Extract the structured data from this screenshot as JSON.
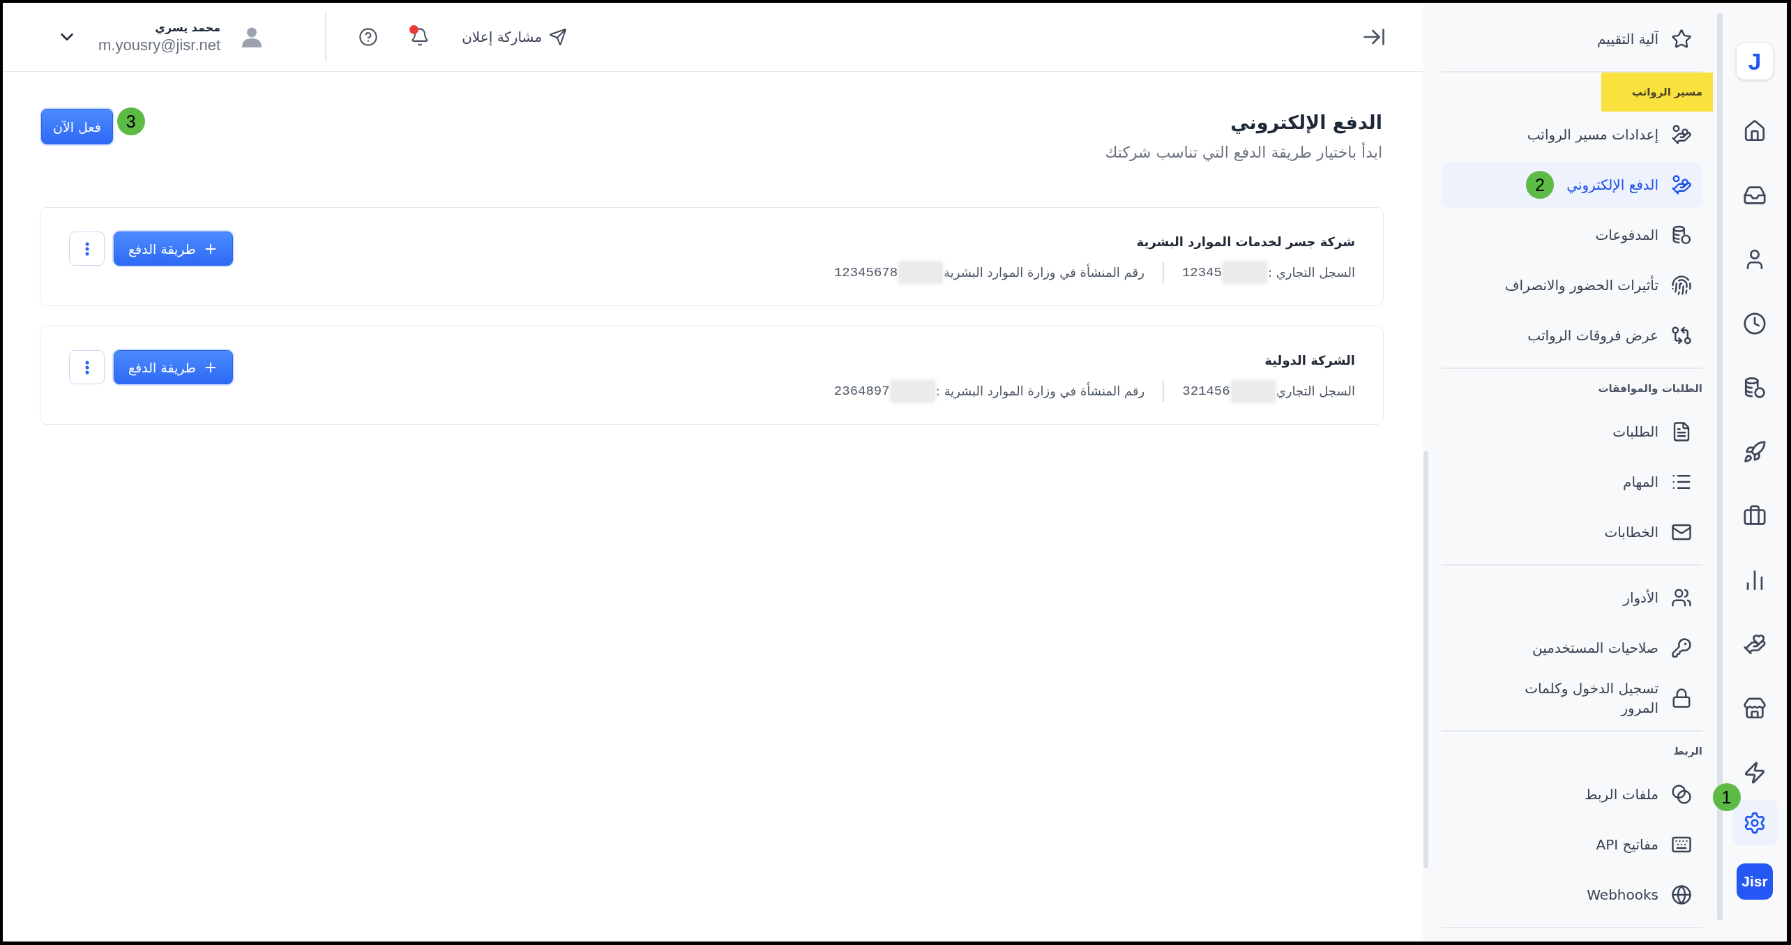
{
  "header": {
    "share_announcement": {
      "label": "مشاركة إعلان"
    },
    "notifications": {
      "unread": true
    },
    "user": {
      "name": "محمد يسري",
      "email": "m.yousry@jisr.net"
    }
  },
  "page": {
    "title": "الدفع الإلكتروني",
    "subtitle": "ابدأ باختيار طريقة الدفع التي تناسب شركتك",
    "action": {
      "label": "فعل الآن",
      "annotation": "3"
    }
  },
  "companies": [
    {
      "name": "شركة جسر لخدمات الموارد البشرية",
      "fields": [
        {
          "label": "السجل التجاري :",
          "value": "12345",
          "redacted": true
        },
        {
          "label": "رقم المنشأة في وزارة الموارد البشرية",
          "value": "12345678",
          "redacted": true
        }
      ],
      "add_button": "طريقة الدفع"
    },
    {
      "name": "الشركة الدولية",
      "fields": [
        {
          "label": "السجل التجاري",
          "value": "321456",
          "redacted": true
        },
        {
          "label": "رقم المنشأة في وزارة الموارد البشرية :",
          "value": "2364897",
          "redacted": true
        }
      ],
      "add_button": "طريقة الدفع"
    }
  ],
  "sidebar": {
    "sections": [
      {
        "items": [
          {
            "label": "آلية التقييم",
            "selected": false
          }
        ]
      },
      {
        "heading": "مسير الرواتب",
        "highlighted": true,
        "items": [
          {
            "label": "إعدادات مسير الرواتب",
            "selected": false
          },
          {
            "label": "الدفع الإلكتروني",
            "selected": true,
            "annotation": "2"
          },
          {
            "label": "المدفوعات",
            "selected": false
          },
          {
            "label": "تأثيرات الحضور والانصراف",
            "selected": false
          },
          {
            "label": "عرض فروقات الرواتب",
            "selected": false
          }
        ]
      },
      {
        "heading": "الطلبات والموافقات",
        "highlighted": false,
        "items": [
          {
            "label": "الطلبات",
            "selected": false
          },
          {
            "label": "المهام",
            "selected": false
          },
          {
            "label": "الخطابات",
            "selected": false
          }
        ]
      },
      {
        "items": [
          {
            "label": "الأدوار",
            "selected": false
          },
          {
            "label": "صلاحيات المستخدمين",
            "selected": false
          },
          {
            "label": "تسجيل الدخول وكلمات المرور",
            "selected": false
          }
        ]
      },
      {
        "heading": "الربط",
        "highlighted": false,
        "items": [
          {
            "label": "ملفات الربط",
            "selected": false
          },
          {
            "label": "مفاتيح API",
            "selected": false
          },
          {
            "label": "Webhooks",
            "selected": false
          }
        ]
      }
    ]
  },
  "rail": {
    "logo": "J",
    "items": [
      {
        "selected": false
      },
      {
        "selected": false
      },
      {
        "selected": false
      },
      {
        "selected": false
      },
      {
        "selected": false
      },
      {
        "selected": false
      },
      {
        "selected": false
      },
      {
        "selected": false
      },
      {
        "selected": false
      },
      {
        "selected": false
      },
      {
        "selected": false
      }
    ],
    "footer_items": [
      {
        "selected": true,
        "annotation": "1"
      }
    ],
    "brand": "Jisr"
  }
}
